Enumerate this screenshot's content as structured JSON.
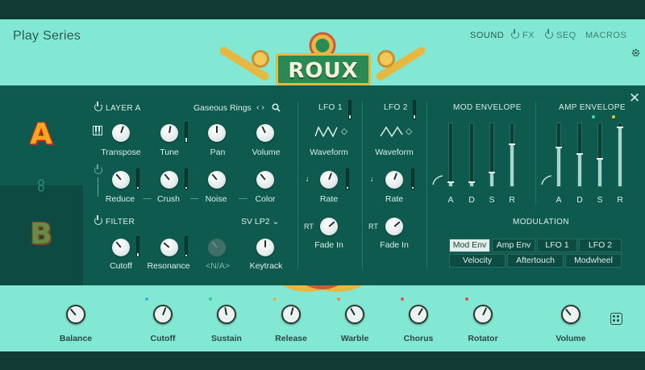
{
  "header": {
    "brand": "Play Series",
    "logo": "ROUX",
    "nav": {
      "sound": "SOUND",
      "fx": "FX",
      "seq": "SEQ",
      "macros": "MACROS"
    },
    "icons": [
      "power-icon",
      "gear-icon"
    ]
  },
  "layers": {
    "a": "A",
    "b": "B"
  },
  "layer_a": {
    "title": "LAYER A",
    "preset": "Gaseous Rings",
    "knobs1": [
      "Transpose",
      "Tune",
      "Pan",
      "Volume"
    ],
    "knobs2": [
      "Reduce",
      "Crush",
      "Noise",
      "Color"
    ],
    "separators": [
      "—",
      "—",
      "—"
    ]
  },
  "filter": {
    "title": "FILTER",
    "type": "SV LP2",
    "knobs": [
      "Cutoff",
      "Resonance",
      "<N/A>",
      "Keytrack"
    ]
  },
  "lfo1": {
    "title": "LFO 1",
    "waveform": "Waveform",
    "rate": "Rate",
    "fade": "Fade In",
    "rt": "RT"
  },
  "lfo2": {
    "title": "LFO 2",
    "waveform": "Waveform",
    "rate": "Rate",
    "fade": "Fade In",
    "rt": "RT"
  },
  "mod_env": {
    "title": "MOD ENVELOPE",
    "labels": [
      "A",
      "D",
      "S",
      "R"
    ],
    "levels": [
      0.05,
      0.05,
      0.2,
      0.65
    ]
  },
  "amp_env": {
    "title": "AMP ENVELOPE",
    "labels": [
      "A",
      "D",
      "S",
      "R"
    ],
    "levels": [
      0.6,
      0.5,
      0.42,
      0.92
    ]
  },
  "modulation": {
    "title": "MODULATION",
    "row1": [
      "Mod Env",
      "Amp Env",
      "LFO 1",
      "LFO 2"
    ],
    "row2": [
      "Velocity",
      "Aftertouch",
      "Modwheel"
    ],
    "active": "Mod Env"
  },
  "footer": {
    "knobs": [
      "Balance",
      "Cutoff",
      "Sustain",
      "Release",
      "Warble",
      "Chorus",
      "Rotator",
      "Volume"
    ],
    "indicator_colors": [
      "#3bb5e0",
      "#2fd18a",
      "#f0a93a",
      "#f08a3a",
      "#e05050",
      "#e04a4a"
    ]
  }
}
